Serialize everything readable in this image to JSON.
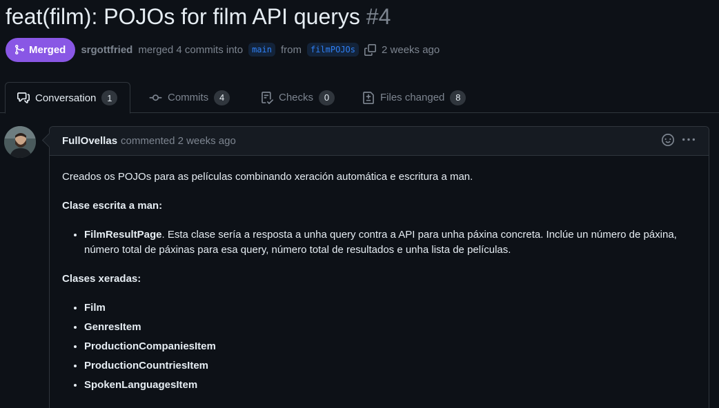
{
  "pr": {
    "title": "feat(film): POJOs for film API querys",
    "number": "#4",
    "state": "Merged",
    "author": "srgottfried",
    "merged_text": "merged 4 commits into",
    "base_branch": "main",
    "from_text": "from",
    "head_branch": "filmPOJOs",
    "time": "2 weeks ago"
  },
  "tabs": [
    {
      "label": "Conversation",
      "count": "1",
      "icon": "comment-discussion-icon"
    },
    {
      "label": "Commits",
      "count": "4",
      "icon": "git-commit-icon"
    },
    {
      "label": "Checks",
      "count": "0",
      "icon": "checklist-icon"
    },
    {
      "label": "Files changed",
      "count": "8",
      "icon": "file-diff-icon"
    }
  ],
  "comment": {
    "author": "FullOvellas",
    "meta": "commented 2 weeks ago",
    "intro": "Creados os POJOs para as películas combinando xeración automática e escritura a man.",
    "manual_heading": "Clase escrita a man:",
    "manual_item_name": "FilmResultPage",
    "manual_item_text": ". Esta clase sería a resposta a unha query contra a API para unha páxina concreta. Inclúe un número de páxina, número total de páxinas para esa query, número total de resultados e unha lista de películas.",
    "generated_heading": "Clases xeradas:",
    "generated_items": [
      "Film",
      "GenresItem",
      "ProductionCompaniesItem",
      "ProductionCountriesItem",
      "SpokenLanguagesItem"
    ]
  },
  "colors": {
    "merged": "#8957e5",
    "background": "#0d1117",
    "link": "#2f81f7"
  }
}
